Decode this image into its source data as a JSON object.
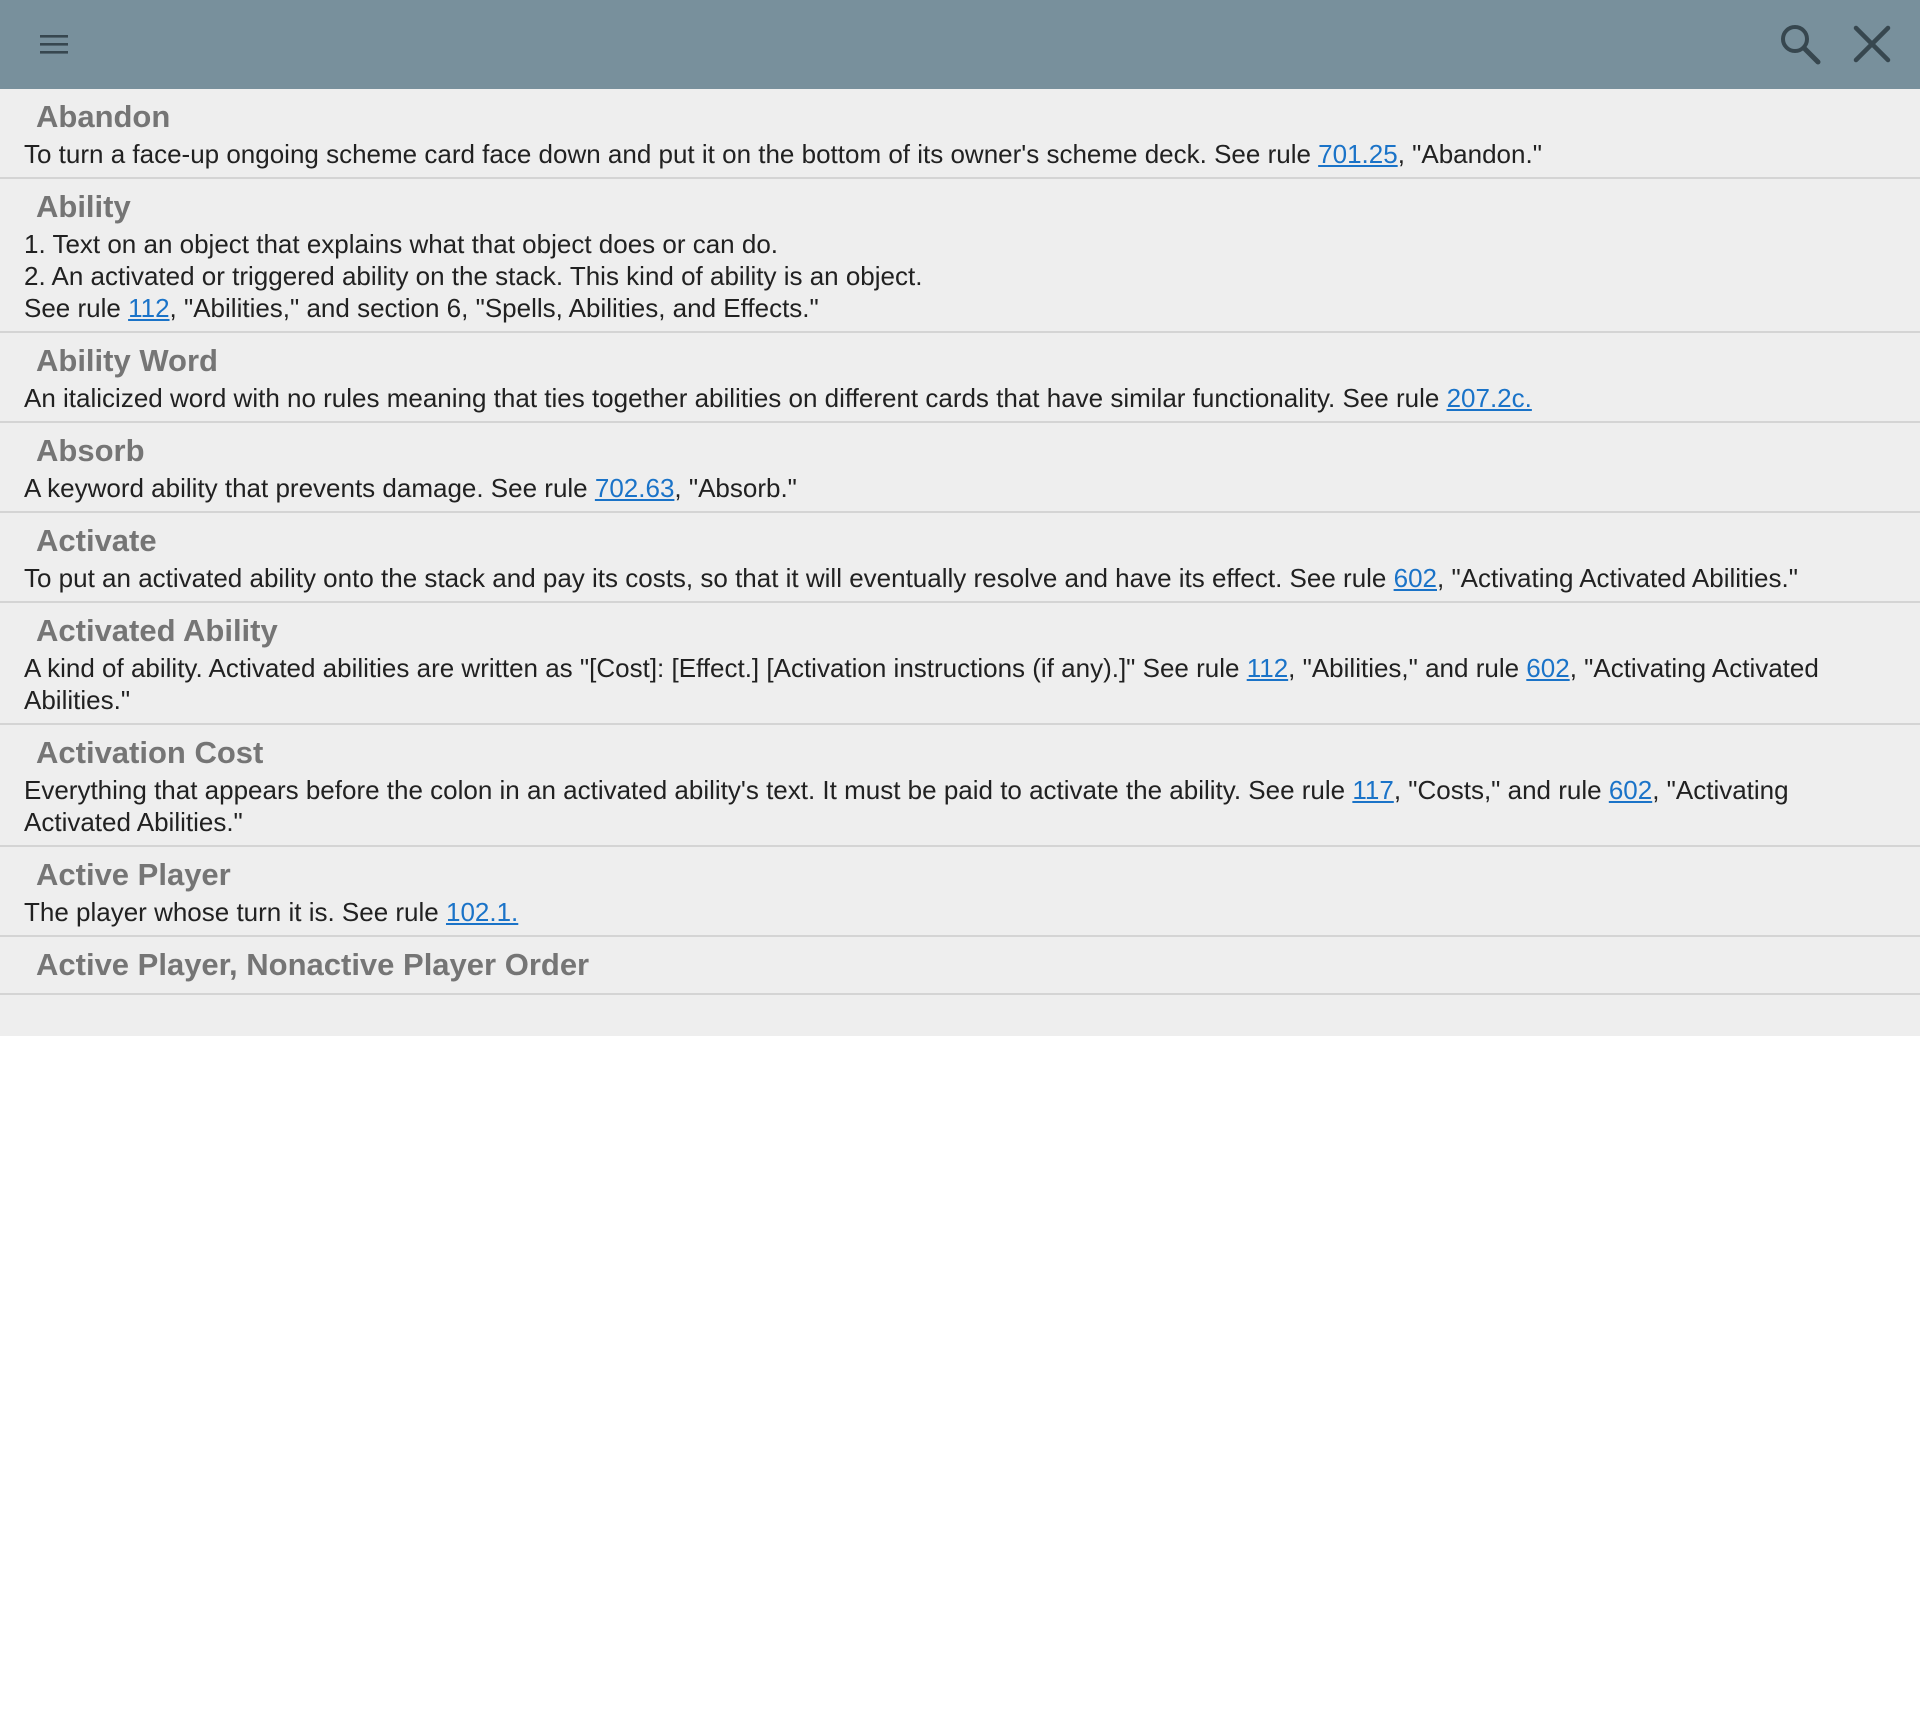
{
  "toolbar": {
    "menu_icon": "menu-icon",
    "search_icon": "search-icon",
    "close_icon": "close-icon",
    "bar_color": "#78909c"
  },
  "entries": [
    {
      "term": "Abandon",
      "lines": [
        [
          {
            "text": "To turn a face-up ongoing scheme card face down and put it on the bottom of its owner's scheme deck. See rule "
          },
          {
            "text": "701.25",
            "link": true
          },
          {
            "text": ", \"Abandon.\""
          }
        ]
      ]
    },
    {
      "term": "Ability",
      "lines": [
        [
          {
            "text": "1. Text on an object that explains what that object does or can do."
          }
        ],
        [
          {
            "text": "2. An activated or triggered ability on the stack. This kind of ability is an object."
          }
        ],
        [
          {
            "text": "See rule "
          },
          {
            "text": "112",
            "link": true
          },
          {
            "text": ", \"Abilities,\" and section 6, \"Spells, Abilities, and Effects.\""
          }
        ]
      ]
    },
    {
      "term": "Ability Word",
      "lines": [
        [
          {
            "text": "An italicized word with no rules meaning that ties together abilities on different cards that have similar functionality. See rule "
          },
          {
            "text": "207.2c.",
            "link": true
          }
        ]
      ]
    },
    {
      "term": "Absorb",
      "lines": [
        [
          {
            "text": "A keyword ability that prevents damage. See rule "
          },
          {
            "text": "702.63",
            "link": true
          },
          {
            "text": ", \"Absorb.\""
          }
        ]
      ]
    },
    {
      "term": "Activate",
      "lines": [
        [
          {
            "text": "To put an activated ability onto the stack and pay its costs, so that it will eventually resolve and have its effect. See rule "
          },
          {
            "text": "602",
            "link": true
          },
          {
            "text": ", \"Activating Activated Abilities.\""
          }
        ]
      ]
    },
    {
      "term": "Activated Ability",
      "lines": [
        [
          {
            "text": "A kind of ability. Activated abilities are written as \"[Cost]: [Effect.] [Activation instructions (if any).]\" See rule "
          },
          {
            "text": "112",
            "link": true
          },
          {
            "text": ", \"Abilities,\" and rule "
          },
          {
            "text": "602",
            "link": true
          },
          {
            "text": ", \"Activating Activated Abilities.\""
          }
        ]
      ]
    },
    {
      "term": "Activation Cost",
      "lines": [
        [
          {
            "text": "Everything that appears before the colon in an activated ability's text. It must be paid to activate the ability. See rule "
          },
          {
            "text": "117",
            "link": true
          },
          {
            "text": ", \"Costs,\" and rule "
          },
          {
            "text": "602",
            "link": true
          },
          {
            "text": ", \"Activating Activated Abilities.\""
          }
        ]
      ]
    },
    {
      "term": "Active Player",
      "lines": [
        [
          {
            "text": "The player whose turn it is. See rule "
          },
          {
            "text": "102.1.",
            "link": true
          }
        ]
      ]
    },
    {
      "term": "Active Player, Nonactive Player Order",
      "lines": []
    }
  ]
}
